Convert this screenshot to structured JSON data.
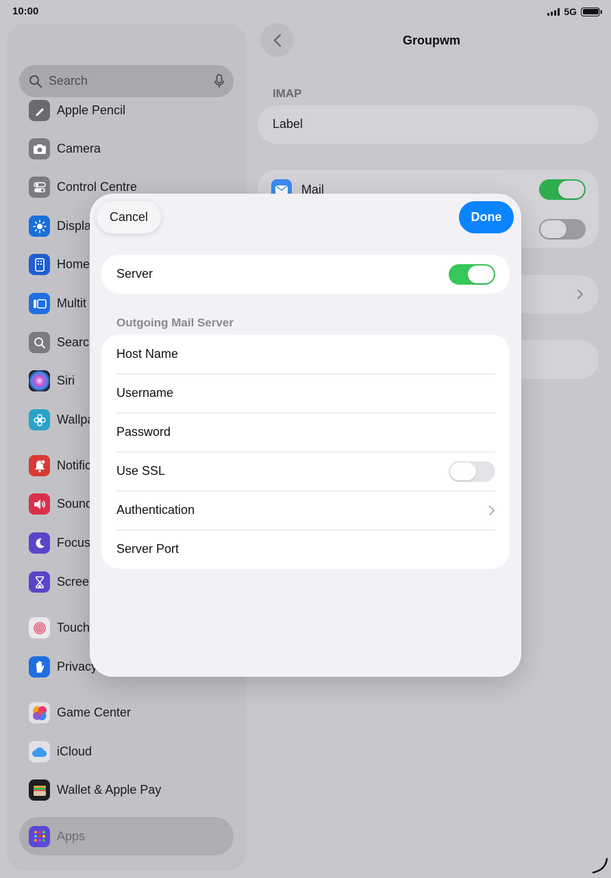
{
  "status_bar": {
    "time": "10:00",
    "network": "5G"
  },
  "sidebar": {
    "search_placeholder": "Search",
    "items": [
      {
        "label": "Apple Pencil",
        "icon": "pencil-icon",
        "color": "#6b6a70"
      },
      {
        "label": "Camera",
        "icon": "camera-icon",
        "color": "#7c7b80"
      },
      {
        "label": "Control Centre",
        "icon": "toggles-icon",
        "color": "#7c7b80"
      },
      {
        "label": "Displa",
        "icon": "sun-icon",
        "color": "#1a6fd8"
      },
      {
        "label": "Home",
        "icon": "home-screen-icon",
        "color": "#1f5fd0"
      },
      {
        "label": "Multit",
        "icon": "multitasking-icon",
        "color": "#1f6fe0"
      },
      {
        "label": "Searc",
        "icon": "search-icon",
        "color": "#7c7b80"
      },
      {
        "label": "Siri",
        "icon": "siri-icon",
        "color": "#2a2a40"
      },
      {
        "label": "Wallpa",
        "icon": "flower-icon",
        "color": "#2aa3c8"
      },
      {
        "label": "Notific",
        "icon": "bell-icon",
        "color": "#d93a35"
      },
      {
        "label": "Sound",
        "icon": "speaker-icon",
        "color": "#d8314a"
      },
      {
        "label": "Focus",
        "icon": "moon-icon",
        "color": "#5a45c9"
      },
      {
        "label": "Scree",
        "icon": "hourglass-icon",
        "color": "#5a45c9"
      },
      {
        "label": "Touch",
        "icon": "fingerprint-icon",
        "color": "#e9e8ec"
      },
      {
        "label": "Privacy",
        "icon": "hand-icon",
        "color": "#1f6fe0"
      },
      {
        "label": "Game Center",
        "icon": "game-center-icon",
        "color": "#e2e1e6"
      },
      {
        "label": "iCloud",
        "icon": "cloud-icon",
        "color": "#e2e1e6"
      },
      {
        "label": "Wallet & Apple Pay",
        "icon": "wallet-icon",
        "color": "#1d1d1f"
      }
    ],
    "apps_label": "Apps"
  },
  "detail": {
    "title": "Groupwm",
    "section_header": "IMAP",
    "label_row": "Label",
    "mail_row": "Mail"
  },
  "sheet": {
    "cancel_label": "Cancel",
    "done_label": "Done",
    "server_row": {
      "label": "Server",
      "enabled": true
    },
    "outgoing_header": "Outgoing Mail Server",
    "rows": [
      {
        "label": "Host Name"
      },
      {
        "label": "Username"
      },
      {
        "label": "Password"
      },
      {
        "label": "Use SSL",
        "toggle": false
      },
      {
        "label": "Authentication",
        "chevron": true
      },
      {
        "label": "Server Port"
      }
    ]
  },
  "colors": {
    "accent": "#0a84ff",
    "toggle_on": "#34c759",
    "toggle_off": "#e3e3e8"
  }
}
